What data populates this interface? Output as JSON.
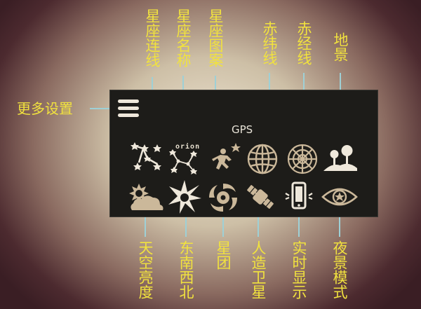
{
  "callouts": {
    "more_settings": "更多设置",
    "constellation_lines": "星座连线",
    "constellation_names": "星座名称",
    "constellation_art": "星座图案",
    "equatorial_grid": "赤纬线",
    "ecliptic": "赤经线",
    "horizon": "地景",
    "sky_brightness": "天空亮度",
    "compass_points": "东南西北",
    "nebulae": "星团",
    "satellites": "人造卫星",
    "realtime_mode": "实时显示",
    "night_mode": "夜景模式"
  },
  "panel": {
    "gps_label": "GPS",
    "orion_label": "orion"
  },
  "icons": {
    "menu": "hamburger-menu-icon",
    "constellation_lines": "constellation-lines-icon",
    "constellation_names": "constellation-names-icon",
    "constellation_art": "constellation-art-icon",
    "equatorial_grid": "globe-grid-icon",
    "ecliptic": "radial-grid-icon",
    "horizon": "horizon-trees-icon",
    "sky_brightness": "sun-cloud-icon",
    "compass_points": "compass-star-icon",
    "nebulae": "galaxy-spiral-icon",
    "satellites": "satellite-icon",
    "realtime_mode": "phone-realtime-icon",
    "night_mode": "eye-star-icon"
  },
  "colors": {
    "callout_text": "#f1e23e",
    "leader_line": "#9ed0d6",
    "panel_bg": "#1d1c19",
    "icon_light": "#efe8db",
    "icon_tan": "#cbb89a"
  }
}
